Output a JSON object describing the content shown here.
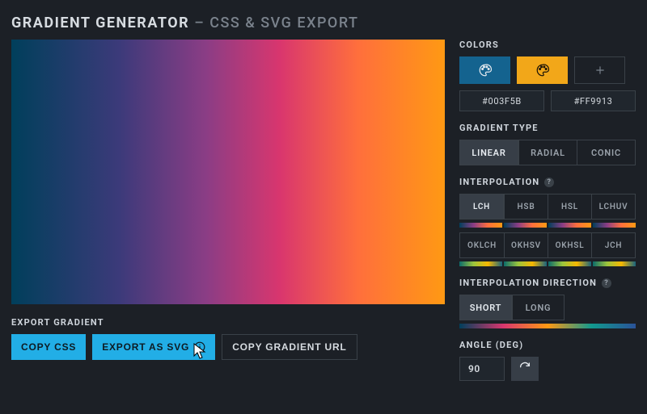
{
  "title": {
    "main": "GRADIENT GENERATOR",
    "separator": "–",
    "sub": "CSS & SVG EXPORT"
  },
  "gradient": {
    "start": "#003F5B",
    "end": "#FF9913"
  },
  "right": {
    "colors_label": "COLORS",
    "hex1": "#003F5B",
    "hex2": "#FF9913",
    "type_label": "GRADIENT TYPE",
    "types": [
      "LINEAR",
      "RADIAL",
      "CONIC"
    ],
    "type_selected": "LINEAR",
    "interp_label": "INTERPOLATION",
    "interp_options_row1": [
      "LCH",
      "HSB",
      "HSL",
      "LCHUV"
    ],
    "interp_options_row2": [
      "OKLCH",
      "OKHSV",
      "OKHSL",
      "JCH"
    ],
    "interp_selected": "LCH",
    "dir_label": "INTERPOLATION DIRECTION",
    "dirs": [
      "SHORT",
      "LONG"
    ],
    "dir_selected": "SHORT",
    "angle_label": "ANGLE (DEG)",
    "angle_value": "90"
  },
  "export": {
    "label": "EXPORT GRADIENT",
    "copy_css": "COPY CSS",
    "export_svg": "EXPORT AS SVG",
    "copy_url": "COPY GRADIENT URL"
  }
}
